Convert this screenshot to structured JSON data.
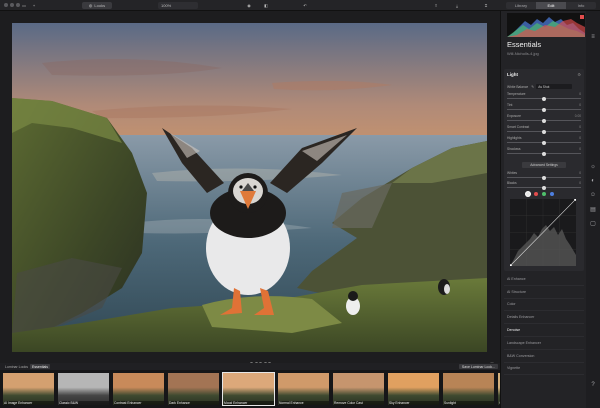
{
  "toolbar": {
    "looks_label": "Looks",
    "zoom_label": "100%",
    "tabs": [
      {
        "label": "Library",
        "active": false
      },
      {
        "label": "Edit",
        "active": true
      },
      {
        "label": "Info",
        "active": false
      }
    ]
  },
  "canvas": {
    "filename": "Will-Nicholls-4.jpg",
    "rating_dots": 5
  },
  "filmstrip": {
    "tabs": [
      "Luminar Looks",
      "Essentials"
    ],
    "save_label": "Save Luminar Look...",
    "items": [
      {
        "label": "AI Image Enhancer",
        "active": false
      },
      {
        "label": "Classic B&W",
        "active": false
      },
      {
        "label": "Contrast Enhancer",
        "active": false
      },
      {
        "label": "Dark Enhance",
        "active": false
      },
      {
        "label": "Mood Enhancer",
        "active": true
      },
      {
        "label": "Normal Enhance",
        "active": false
      },
      {
        "label": "Remove Color Cast",
        "active": false
      },
      {
        "label": "Sky Enhancer",
        "active": false
      },
      {
        "label": "Sunlight",
        "active": false
      },
      {
        "label": "Vivid",
        "active": false
      }
    ]
  },
  "panel": {
    "title": "Essentials",
    "subtitle": "Will-Nicholls-4.jpg",
    "light_section": {
      "title": "Light",
      "white_balance_label": "White Balance",
      "white_balance_value": "As Shot",
      "sliders": [
        {
          "label": "Temperature",
          "value": "0",
          "level": 0.5
        },
        {
          "label": "Tint",
          "value": "0",
          "level": 0.5
        },
        {
          "label": "Exposure",
          "value": "0.00",
          "level": 0.5
        },
        {
          "label": "Smart Contrast",
          "value": "0",
          "level": 0.5
        },
        {
          "label": "Highlights",
          "value": "0",
          "level": 0.5
        },
        {
          "label": "Shadows",
          "value": "0",
          "level": 0.5
        }
      ],
      "advanced_label": "Advanced Settings",
      "lower_sliders": [
        {
          "label": "Whites",
          "value": "0",
          "level": 0.5
        },
        {
          "label": "Blacks",
          "value": "0",
          "level": 0.5
        }
      ],
      "channel_colors": [
        "#e8e8e8",
        "#e24d4d",
        "#4fbf6b",
        "#4d7fe0"
      ]
    },
    "tools": [
      {
        "label": "AI Enhance",
        "highlight": false
      },
      {
        "label": "AI Structure",
        "highlight": false
      },
      {
        "label": "Color",
        "highlight": false
      },
      {
        "label": "Details Enhancer",
        "highlight": false
      },
      {
        "label": "Denoise",
        "highlight": true
      },
      {
        "label": "Landscape Enhancer",
        "highlight": false
      },
      {
        "label": "B&W Conversion",
        "highlight": false
      },
      {
        "label": "Vignette",
        "highlight": false
      }
    ]
  },
  "rail": {
    "icons": [
      "sun-icon",
      "palette-icon",
      "face-icon",
      "layers-icon",
      "square-icon",
      "help-icon"
    ]
  }
}
